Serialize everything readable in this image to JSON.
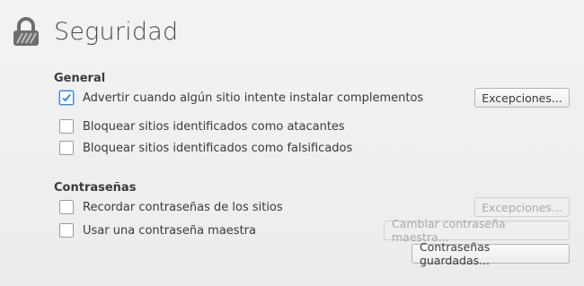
{
  "page": {
    "title": "Seguridad",
    "icon": "lock-icon"
  },
  "general": {
    "heading": "General",
    "warn_addons": {
      "label": "Advertir cuando algún sitio intente instalar complementos",
      "checked": true
    },
    "exceptions_button": "Excepciones...",
    "block_attack": {
      "label": "Bloquear sitios identificados como atacantes",
      "checked": false
    },
    "block_forgery": {
      "label": "Bloquear sitios identificados como falsificados",
      "checked": false
    }
  },
  "passwords": {
    "heading": "Contraseñas",
    "remember": {
      "label": "Recordar contraseñas de los sitios",
      "checked": false
    },
    "exceptions_button": "Excepciones...",
    "master": {
      "label": "Usar una contraseña maestra",
      "checked": false
    },
    "change_master_button": "Cambiar contraseña maestra...",
    "saved_button": "Contraseñas guardadas..."
  },
  "colors": {
    "accent": "#3a8be0",
    "icon": "#6e6e6e"
  }
}
